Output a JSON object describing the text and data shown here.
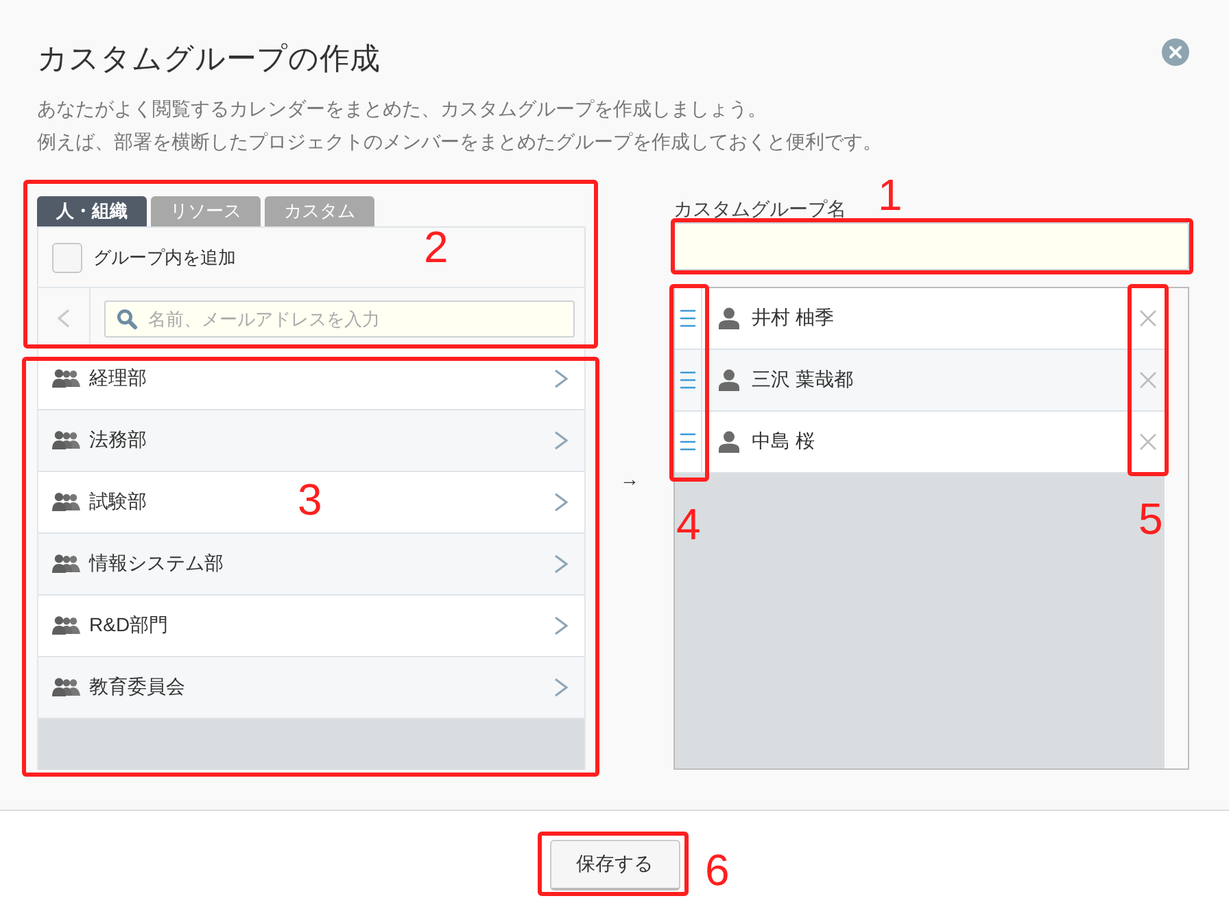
{
  "dialog": {
    "title": "カスタムグループの作成",
    "description": [
      "あなたがよく閲覧するカレンダーをまとめた、カスタムグループを作成しましょう。",
      "例えば、部署を横断したプロジェクトのメンバーをまとめたグループを作成しておくと便利です。"
    ]
  },
  "source_panel": {
    "tabs": [
      {
        "label": "人・組織",
        "selected": true
      },
      {
        "label": "リソース",
        "selected": false
      },
      {
        "label": "カスタム",
        "selected": false
      }
    ],
    "include_group": {
      "label": "グループ内を追加",
      "checked": false
    },
    "search": {
      "placeholder": "名前、メールアドレスを入力"
    },
    "groups": [
      {
        "name": "経理部"
      },
      {
        "name": "法務部"
      },
      {
        "name": "試験部"
      },
      {
        "name": "情報システム部"
      },
      {
        "name": "R&D部門"
      },
      {
        "name": "教育委員会"
      }
    ]
  },
  "transfer_arrow": "→",
  "custom_group": {
    "name_label": "カスタムグループ名",
    "members": [
      {
        "name": "井村 柚季"
      },
      {
        "name": "三沢 葉哉都"
      },
      {
        "name": "中島 桜"
      }
    ]
  },
  "footer": {
    "save_button": "保存する"
  },
  "annotations": [
    {
      "number": "1"
    },
    {
      "number": "2"
    },
    {
      "number": "3"
    },
    {
      "number": "4"
    },
    {
      "number": "5"
    },
    {
      "number": "6"
    }
  ]
}
